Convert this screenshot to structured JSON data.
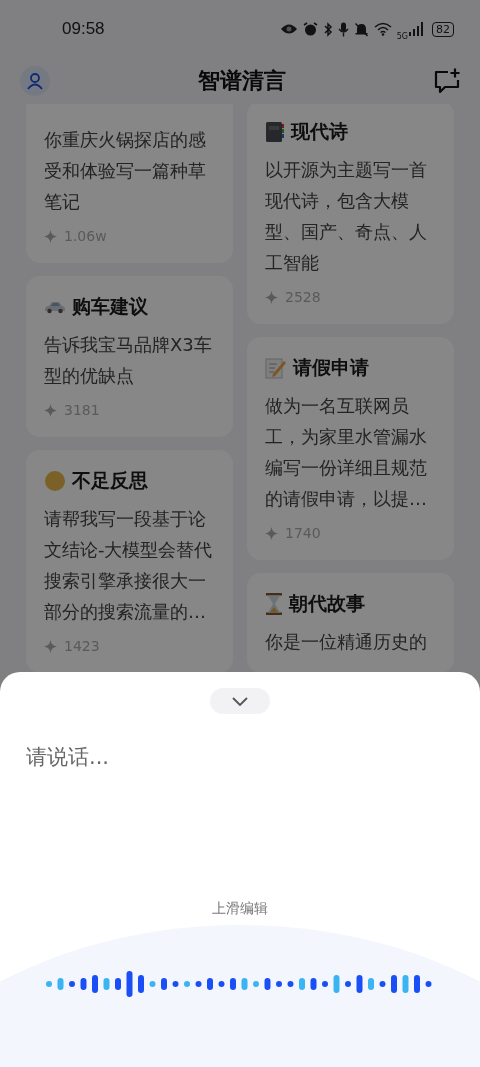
{
  "status_bar": {
    "time": "09:58",
    "network": "5G",
    "battery": "82"
  },
  "header": {
    "title": "智谱清言"
  },
  "columns": [
    [
      {
        "prompt": "你重庆火锅探店的感受和体验写一篇种草笔记",
        "count": "1.06w"
      },
      {
        "title": "购车建议",
        "prompt": "告诉我宝马品牌X3车型的优缺点",
        "count": "3181"
      },
      {
        "title": "不足反思",
        "prompt": "请帮我写一段基于论文结论-大模型会替代搜索引擎承接很大一部分的搜索流量的…",
        "count": "1423"
      }
    ],
    [
      {
        "title": "现代诗",
        "prompt": "以开源为主题写一首现代诗，包含大模型、国产、奇点、人工智能",
        "count": "2528"
      },
      {
        "title": "请假申请",
        "prompt": "做为一名互联网员工，为家里水管漏水编写一份详细且规范的请假申请，以提…",
        "count": "1740"
      },
      {
        "title": "朝代故事",
        "prompt": "你是一位精通历史的"
      }
    ]
  ],
  "voice_sheet": {
    "status_text": "请说话...",
    "hint": "上滑编辑"
  }
}
